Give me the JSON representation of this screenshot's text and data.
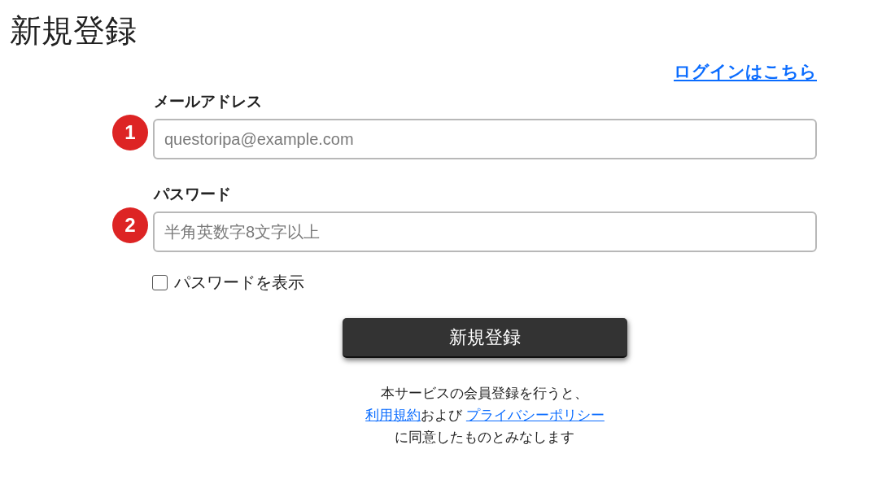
{
  "page": {
    "title": "新規登録"
  },
  "login_link": "ログインはこちら",
  "fields": [
    {
      "marker": "1",
      "label": "メールアドレス",
      "placeholder": "questoripa@example.com"
    },
    {
      "marker": "2",
      "label": "パスワード",
      "placeholder": "半角英数字8文字以上"
    }
  ],
  "show_password": {
    "label": "パスワードを表示",
    "checked": false
  },
  "submit_button": "新規登録",
  "terms": {
    "lines": [
      [
        {
          "kind": "text",
          "text": "本サービスの会員登録を行うと、"
        }
      ],
      [
        {
          "kind": "link",
          "text": "利用規約"
        },
        {
          "kind": "text",
          "text": "および "
        },
        {
          "kind": "link",
          "text": "プライバシーポリシー"
        }
      ],
      [
        {
          "kind": "text",
          "text": "に同意したものとみなします"
        }
      ]
    ]
  }
}
